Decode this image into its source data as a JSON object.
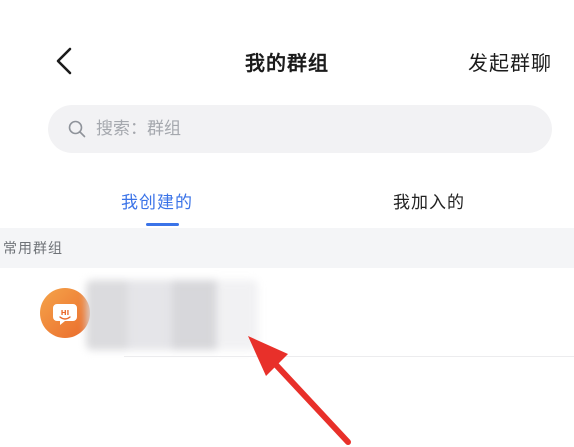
{
  "header": {
    "back_icon": "chevron-left-icon",
    "title": "我的群组",
    "start_group_chat": "发起群聊"
  },
  "search": {
    "icon": "search-icon",
    "placeholder": "搜索：群组",
    "value": ""
  },
  "tabs": [
    {
      "label": "我创建的",
      "active": true
    },
    {
      "label": "我加入的",
      "active": false
    }
  ],
  "section": {
    "title": "常用群组"
  },
  "groups": [
    {
      "avatar_icon": "hi-chat-bubble-icon",
      "avatar_text": "HI",
      "name": ""
    }
  ],
  "colors": {
    "accent": "#3a73e8",
    "avatar_orange": "#ea6a2b",
    "annotation_red": "#e8302a",
    "section_bg": "#f4f5f7",
    "search_bg": "#f2f2f4"
  }
}
